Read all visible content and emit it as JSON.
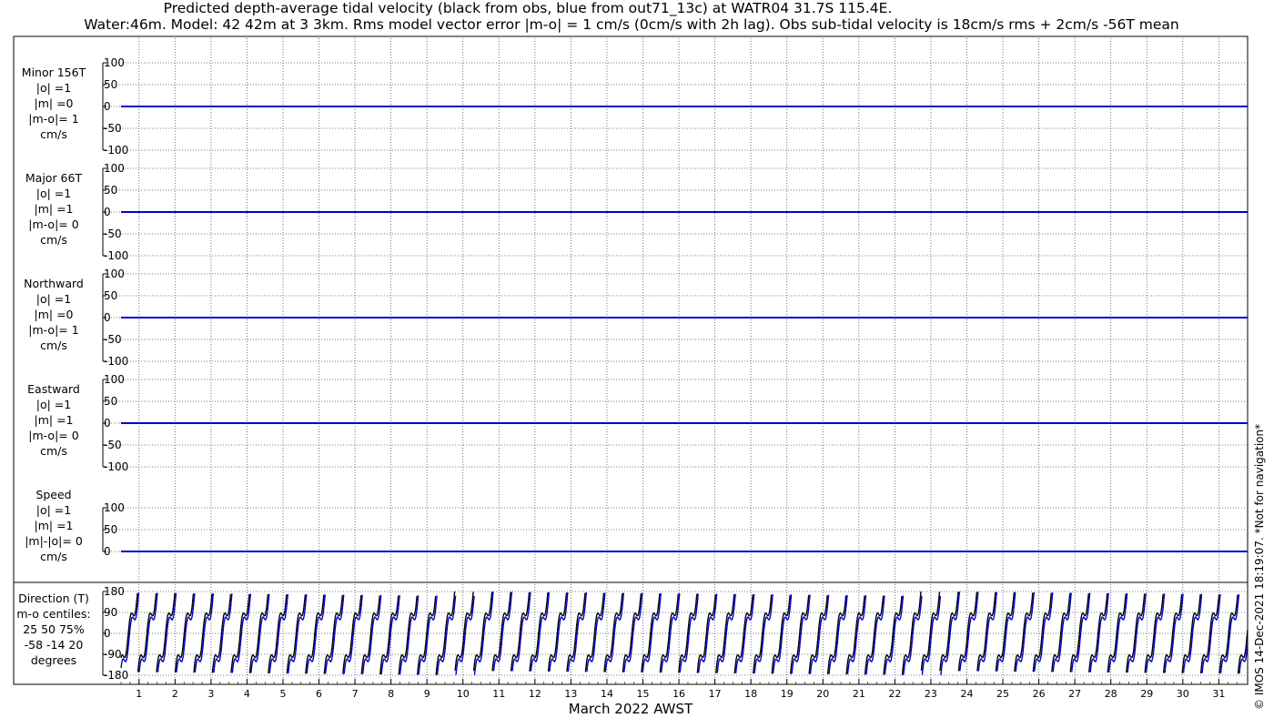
{
  "title_line1": "Predicted depth-average tidal velocity (black from obs, blue from out71_13c) at WATR04 31.7S 115.4E.",
  "title_line2": "Water:46m. Model: 42 42m at 3 3km. Rms model vector error |m-o| = 1 cm/s (0cm/s with 2h lag). Obs sub-tidal velocity is 18cm/s rms + 2cm/s -56T mean",
  "side_note": "© IMOS 14-Dec-2021 18:19:07. *Not for navigation*",
  "colors": {
    "obs": "#000000",
    "model": "#0000cc"
  },
  "chart_data": {
    "type": "line",
    "xlabel": "March 2022 AWST",
    "x_ticks": [
      "1",
      "2",
      "3",
      "4",
      "5",
      "6",
      "7",
      "8",
      "9",
      "10",
      "11",
      "12",
      "13",
      "14",
      "15",
      "16",
      "17",
      "18",
      "19",
      "20",
      "21",
      "22",
      "23",
      "24",
      "25",
      "26",
      "27",
      "28",
      "29",
      "30",
      "31"
    ],
    "xlim": [
      0,
      31.3
    ],
    "grid": true,
    "panels": [
      {
        "name": "minor",
        "label_lines": [
          "Minor 156T",
          "|o| =1",
          "|m| =0",
          "|m-o|= 1",
          "cm/s"
        ],
        "ylim": [
          -100,
          100
        ],
        "yticks": [
          "100",
          "50",
          "0",
          "-50",
          "-100"
        ],
        "obs_amp": 1,
        "model_amp": 0
      },
      {
        "name": "major",
        "label_lines": [
          "Major 66T",
          "|o| =1",
          "|m| =1",
          "|m-o|= 0",
          "cm/s"
        ],
        "ylim": [
          -100,
          100
        ],
        "yticks": [
          "100",
          "50",
          "0",
          "-50",
          "-100"
        ],
        "obs_amp": 1,
        "model_amp": 1
      },
      {
        "name": "northward",
        "label_lines": [
          "Northward",
          "|o| =1",
          "|m| =0",
          "|m-o|= 1",
          "cm/s"
        ],
        "ylim": [
          -100,
          100
        ],
        "yticks": [
          "100",
          "50",
          "0",
          "-50",
          "-100"
        ],
        "obs_amp": 1,
        "model_amp": 0
      },
      {
        "name": "eastward",
        "label_lines": [
          "Eastward",
          "|o| =1",
          "|m| =1",
          "|m-o|= 0",
          "cm/s"
        ],
        "ylim": [
          -100,
          100
        ],
        "yticks": [
          "100",
          "50",
          "0",
          "-50",
          "-100"
        ],
        "obs_amp": 1,
        "model_amp": 1
      },
      {
        "name": "speed",
        "label_lines": [
          "Speed",
          "|o| =1",
          "|m| =1",
          "|m|-|o|= 0",
          "cm/s"
        ],
        "ylim": [
          0,
          100
        ],
        "yticks": [
          "100",
          "50",
          "0"
        ],
        "obs_amp": 1,
        "model_amp": 1
      },
      {
        "name": "direction",
        "label_lines": [
          "Direction (T)",
          "m-o centiles:",
          "25  50  75%",
          "-58  -14  20",
          "degrees"
        ],
        "ylim": [
          -180,
          180
        ],
        "yticks": [
          "180",
          "90",
          "0",
          "-90",
          "-180"
        ]
      }
    ]
  }
}
